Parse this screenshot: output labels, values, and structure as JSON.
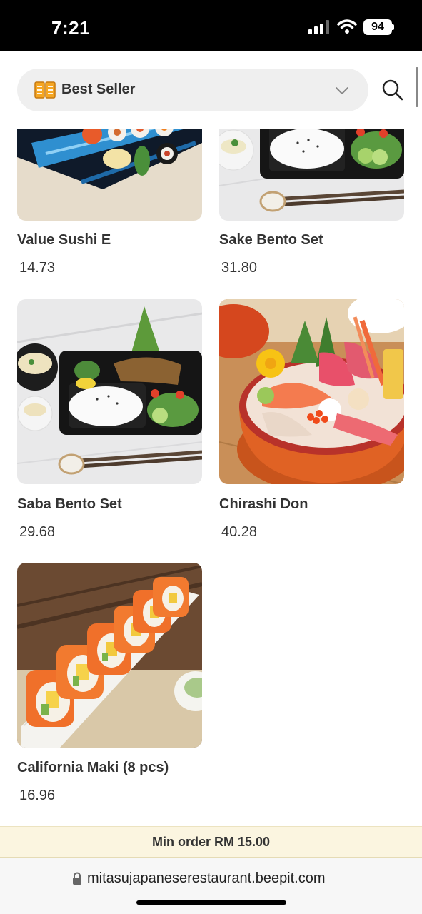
{
  "status_bar": {
    "time": "7:21",
    "battery": "94"
  },
  "header": {
    "category_icon": "book-icon",
    "category_label": "Best Seller",
    "search_icon": "search-icon"
  },
  "products": [
    {
      "name": "Value Sushi E",
      "price": "14.73"
    },
    {
      "name": "Sake Bento Set",
      "price": "31.80"
    },
    {
      "name": "Saba Bento Set",
      "price": "29.68"
    },
    {
      "name": "Chirashi Don",
      "price": "40.28"
    },
    {
      "name": "California Maki (8 pcs)",
      "price": "16.96"
    }
  ],
  "footer": {
    "min_order": "Min order RM 15.00",
    "url": "mitasujapaneserestaurant.beepit.com"
  },
  "colors": {
    "accent": "#f5a623",
    "min_order_bg": "#fbf5e0",
    "status_bar_bg": "#000000"
  }
}
